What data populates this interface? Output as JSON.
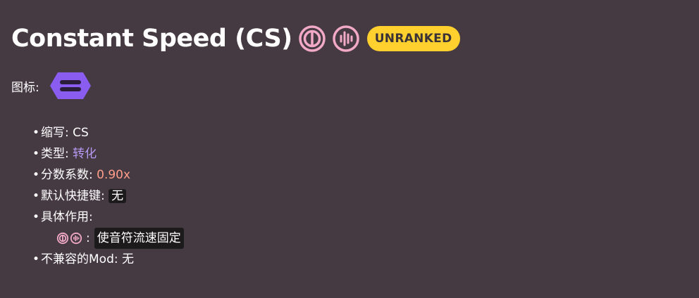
{
  "header": {
    "title": "Constant Speed (CS)",
    "icons": [
      "constant-speed-circle-icon",
      "waveform-circle-icon"
    ],
    "badge": "UNRANKED",
    "badge_color": "#ffd02e",
    "icon_color": "#f2a9c8"
  },
  "icon_row": {
    "label": "图标:",
    "icon": "hexagon-lines-icon",
    "icon_color": "#8a5cf0"
  },
  "properties": {
    "abbr_label": "缩写:",
    "abbr_value": "CS",
    "type_label": "类型:",
    "type_value": "转化",
    "multiplier_label": "分数系数:",
    "multiplier_value": "0.90x",
    "hotkey_label": "默认快捷键:",
    "hotkey_value": "无",
    "effect_label": "具体作用:",
    "effect_colon": ":",
    "effect_value": "使音符流速固定",
    "incompat_label": "不兼容的Mod:",
    "incompat_value": "无"
  },
  "colors": {
    "background": "#463a42",
    "accent_purple": "#b699f2",
    "accent_salmon": "#ff9e8a"
  }
}
